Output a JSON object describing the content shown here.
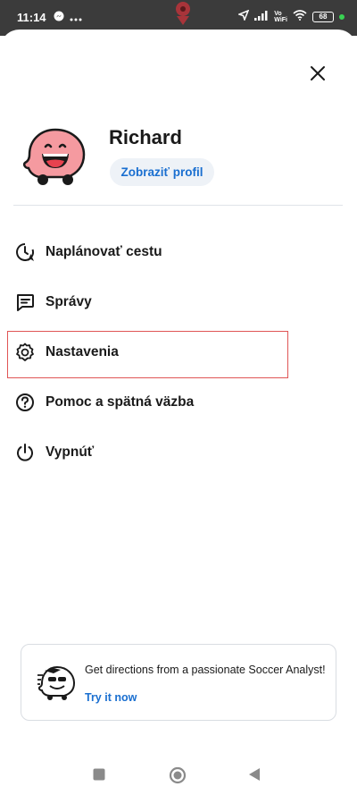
{
  "status_bar": {
    "time": "11:14",
    "signal_label": "Vo\nWiFi",
    "battery": "68"
  },
  "profile": {
    "name": "Richard",
    "view_profile_label": "Zobraziť profil"
  },
  "menu": {
    "items": [
      {
        "label": "Naplánovať cestu",
        "icon": "plan-drive-icon"
      },
      {
        "label": "Správy",
        "icon": "messages-icon"
      },
      {
        "label": "Nastavenia",
        "icon": "settings-gear-icon"
      },
      {
        "label": "Pomoc a spätná väzba",
        "icon": "help-icon"
      },
      {
        "label": "Vypnúť",
        "icon": "power-icon"
      }
    ]
  },
  "promo": {
    "text": "Get directions from a passionate Soccer Analyst!",
    "link": "Try it now"
  },
  "colors": {
    "accent": "#1a6fd0",
    "highlight": "#e05555",
    "avatar": "#f59aa0"
  }
}
